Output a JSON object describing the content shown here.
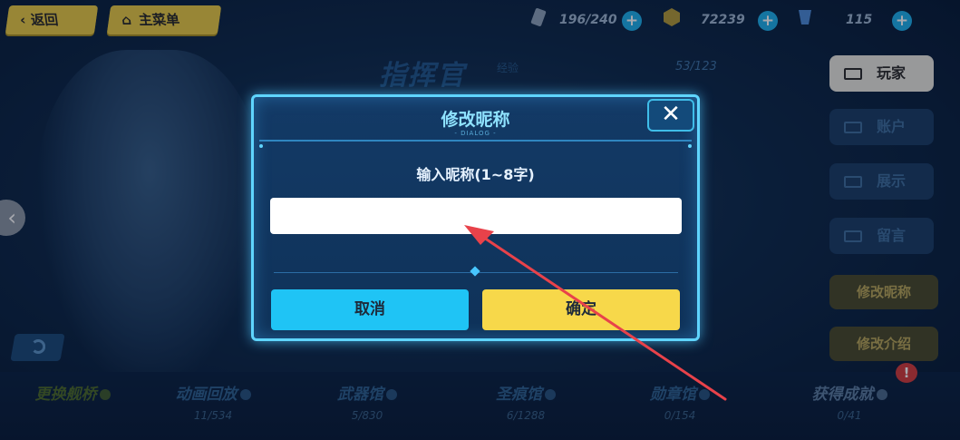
{
  "top_bar": {
    "back_label": "返回",
    "main_menu_label": "主菜单",
    "stamina": "196/240",
    "gold": "72239",
    "crystals": "115",
    "plus_icon": "+",
    "back_icon": "‹",
    "home_icon": "⌂"
  },
  "background": {
    "title": "指挥官",
    "subtitle": "经验",
    "exp_count": "53/123"
  },
  "side_menu": {
    "tabs": [
      "玩家",
      "账户",
      "展示",
      "留言"
    ],
    "actions": [
      "修改昵称",
      "修改介绍"
    ]
  },
  "bottom_bar": {
    "items": [
      {
        "label": "更换舰桥",
        "count": ""
      },
      {
        "label": "动画回放",
        "count": "11/534"
      },
      {
        "label": "武器馆",
        "count": "5/830"
      },
      {
        "label": "圣痕馆",
        "count": "6/1288"
      },
      {
        "label": "勋章馆",
        "count": "0/154"
      },
      {
        "label": "获得成就",
        "count": "0/41"
      }
    ],
    "notification": "!"
  },
  "dialog": {
    "title": "修改昵称",
    "tag": "- DIALOG -",
    "close_icon": "✕",
    "prompt": "输入昵称(1~8字)",
    "input_value": "",
    "cancel_label": "取消",
    "confirm_label": "确定"
  },
  "nav": {
    "left_arrow": "‹"
  },
  "colors": {
    "accent_cyan": "#5fd5ff",
    "confirm_yellow": "#f7d84a",
    "cancel_blue": "#1fc4f5",
    "annotation_red": "#e8424a"
  }
}
